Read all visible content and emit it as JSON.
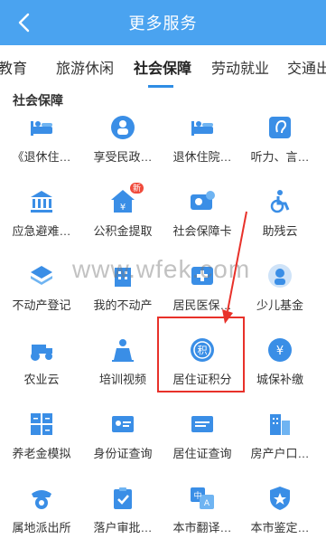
{
  "header": {
    "title": "更多服务"
  },
  "tabs": [
    {
      "label": "教育"
    },
    {
      "label": "旅游休闲"
    },
    {
      "label": "社会保障"
    },
    {
      "label": "劳动就业"
    },
    {
      "label": "交通出"
    }
  ],
  "active_tab": "社会保障",
  "section": {
    "title": "社会保障"
  },
  "items": [
    {
      "label": "《退休住…",
      "icon": "bed-icon"
    },
    {
      "label": "享受民政…",
      "icon": "people-icon"
    },
    {
      "label": "退休住院…",
      "icon": "hospital-bed-icon"
    },
    {
      "label": "听力、言…",
      "icon": "ear-icon"
    },
    {
      "label": "应急避难…",
      "icon": "bank-icon"
    },
    {
      "label": "公积金提取",
      "icon": "house-yen-icon",
      "badge": "新"
    },
    {
      "label": "社会保障卡",
      "icon": "card-icon"
    },
    {
      "label": "助残云",
      "icon": "wheelchair-icon"
    },
    {
      "label": "不动产登记",
      "icon": "layers-icon"
    },
    {
      "label": "我的不动产",
      "icon": "building-icon"
    },
    {
      "label": "居民医保…",
      "icon": "medical-card-icon"
    },
    {
      "label": "少儿基金",
      "icon": "child-icon"
    },
    {
      "label": "农业云",
      "icon": "tractor-icon"
    },
    {
      "label": "培训视频",
      "icon": "teacher-icon"
    },
    {
      "label": "居住证积分",
      "icon": "points-icon"
    },
    {
      "label": "城保补缴",
      "icon": "yen-circle-icon"
    },
    {
      "label": "养老金模拟",
      "icon": "calculator-icon"
    },
    {
      "label": "身份证查询",
      "icon": "id-card-icon"
    },
    {
      "label": "居住证查询",
      "icon": "residence-card-icon"
    },
    {
      "label": "房产户口…",
      "icon": "apartment-icon"
    },
    {
      "label": "属地派出所",
      "icon": "police-icon"
    },
    {
      "label": "落户审批…",
      "icon": "clipboard-check-icon"
    },
    {
      "label": "本市翻译…",
      "icon": "translate-icon"
    },
    {
      "label": "本市鉴定…",
      "icon": "shield-star-icon"
    }
  ],
  "watermark": "www.wfek.com",
  "colors": {
    "header": "#4aa3f0",
    "icon": "#3a8ee6",
    "highlight": "#e8312a"
  }
}
